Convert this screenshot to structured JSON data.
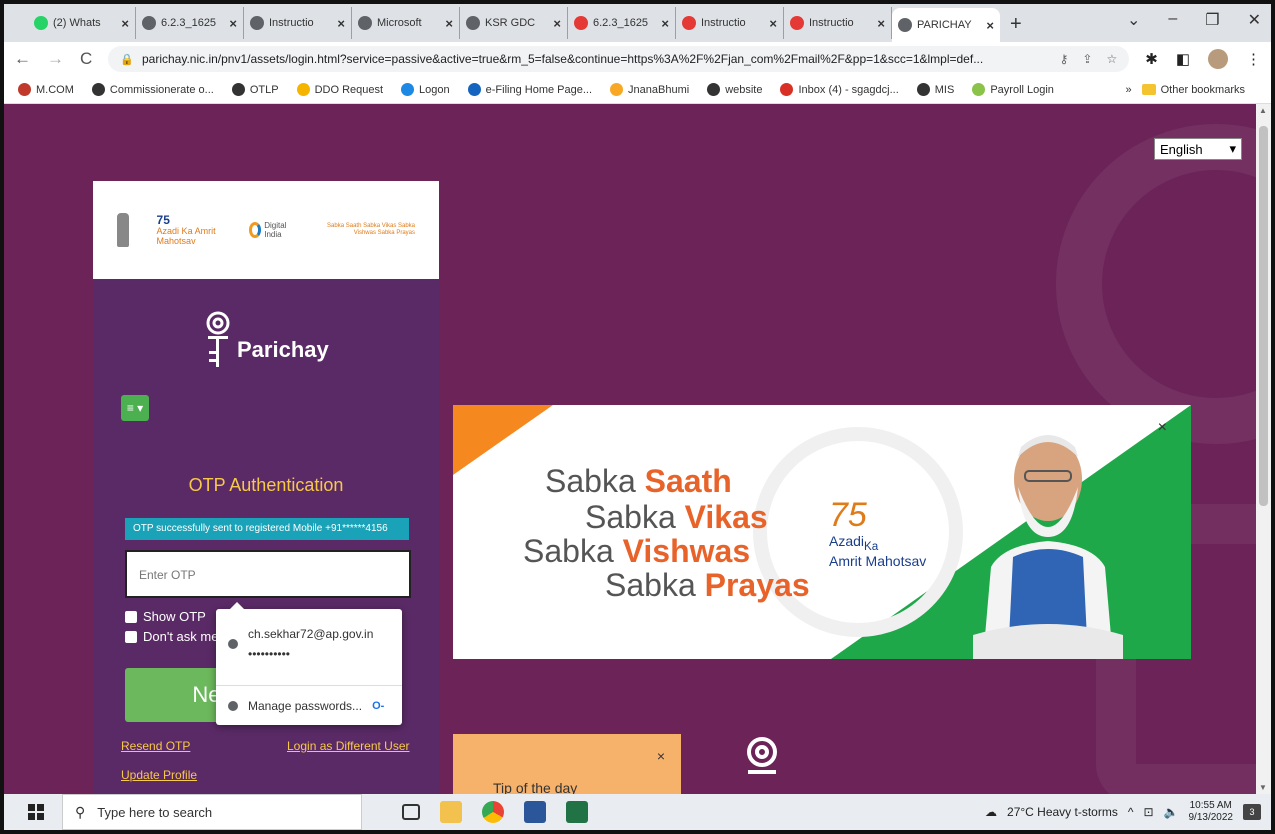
{
  "browser": {
    "tabs": [
      {
        "label": "(2) Whats",
        "color": "#25d366"
      },
      {
        "label": "6.2.3_1625",
        "color": "#5f6368"
      },
      {
        "label": "Instructio",
        "color": "#5f6368"
      },
      {
        "label": "Microsoft",
        "color": "#5f6368"
      },
      {
        "label": "KSR GDC",
        "color": "#5f6368"
      },
      {
        "label": "6.2.3_1625",
        "color": "#e53935"
      },
      {
        "label": "Instructio",
        "color": "#e53935"
      },
      {
        "label": "Instructio",
        "color": "#e53935"
      },
      {
        "label": "PARICHAY",
        "color": "#5f6368"
      }
    ],
    "url": "parichay.nic.in/pnv1/assets/login.html?service=passive&active=true&rm_5=false&continue=https%3A%2F%2Fjan_com%2Fmail%2F&pp=1&scc=1&lmpl=def...",
    "bookmarks": [
      {
        "label": "M.COM",
        "color": "#c0392b"
      },
      {
        "label": "Commissionerate o...",
        "color": "#333"
      },
      {
        "label": "OTLP",
        "color": "#333"
      },
      {
        "label": "DDO Request",
        "color": "#f4b400"
      },
      {
        "label": "Logon",
        "color": "#1e88e5"
      },
      {
        "label": "e-Filing Home Page...",
        "color": "#1565c0"
      },
      {
        "label": "JnanaBhumi",
        "color": "#f9a825"
      },
      {
        "label": "website",
        "color": "#333"
      },
      {
        "label": "Inbox (4) - sgagdcj...",
        "color": "#d93025"
      },
      {
        "label": "MIS",
        "color": "#333"
      },
      {
        "label": "Payroll Login",
        "color": "#8bc34a"
      }
    ],
    "other_bookmarks": "Other bookmarks",
    "more": "»"
  },
  "page": {
    "language": "English",
    "logos": {
      "azadi": "Azadi Ka Amrit Mahotsav",
      "digital_india": "Digital India",
      "sabka": "Sabka Saath Sabka Vikas Sabka Vishwas Sabka Prayas"
    },
    "brand": "Parichay",
    "menu_icon": "≡ ▾",
    "otp_title": "OTP Authentication",
    "otp_message": "OTP successfully sent to registered Mobile +91******4156",
    "otp_placeholder": "Enter OTP",
    "show_otp": "Show OTP",
    "dont_ask": "Don't ask me",
    "next": "Next",
    "resend": "Resend OTP",
    "login_different": "Login as Different User",
    "update_profile": "Update Profile",
    "password_popup": {
      "email": "ch.sekhar72@ap.gov.in",
      "masked": "••••••••••",
      "manage": "Manage passwords..."
    },
    "banner": {
      "line1_a": "Sabka ",
      "line1_b": "Saath",
      "line2_a": "Sabka ",
      "line2_b": "Vikas",
      "line3_a": "Sabka ",
      "line3_b": "Vishwas",
      "line4_a": "Sabka ",
      "line4_b": "Prayas",
      "azadi_num": "75",
      "azadi_1": "Azadi",
      "azadi_ka": "Ka",
      "azadi_2": "Amrit Mahotsav",
      "close": "×"
    },
    "tip": {
      "label": "Tip of the day",
      "close": "×"
    }
  },
  "taskbar": {
    "search_placeholder": "Type here to search",
    "weather": "27°C  Heavy t-storms",
    "time": "10:55 AM",
    "date": "9/13/2022",
    "notifications": "3"
  }
}
